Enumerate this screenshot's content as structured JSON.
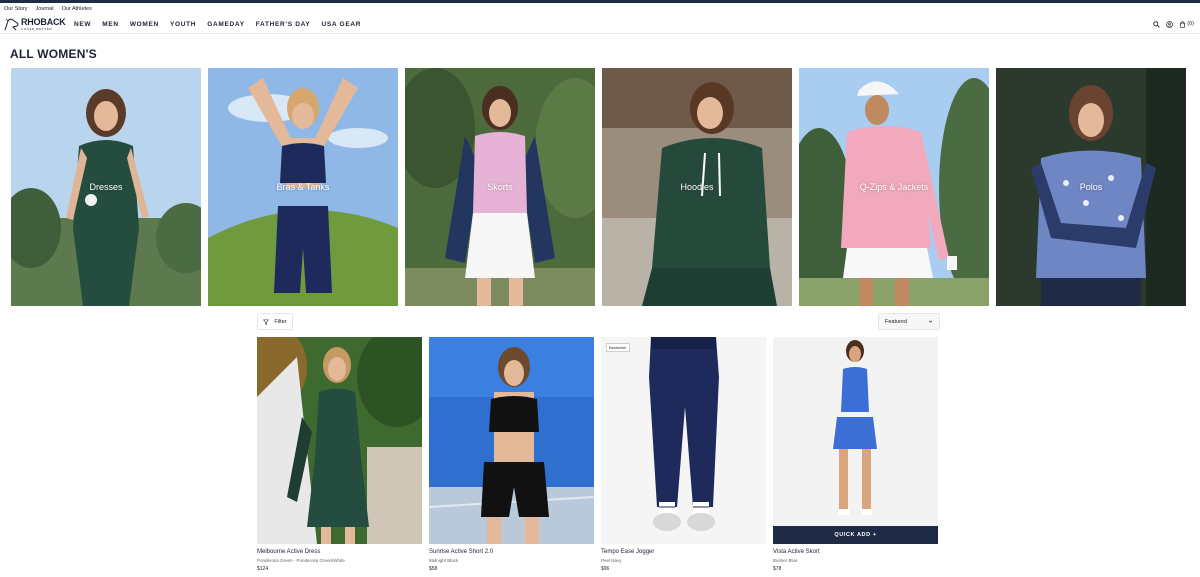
{
  "utility_links": [
    "Our Story",
    "Journal",
    "Our Athletes"
  ],
  "brand": {
    "name": "RHOBACK",
    "tagline": "CHASE BETTER"
  },
  "nav": [
    "NEW",
    "MEN",
    "WOMEN",
    "YOUTH",
    "GAMEDAY",
    "FATHER'S DAY",
    "USA GEAR"
  ],
  "header_icons": [
    "search-icon",
    "account-icon",
    "cart-icon"
  ],
  "cart_count": "(0)",
  "page_title": "ALL WOMEN'S",
  "categories": [
    {
      "label": "Dresses"
    },
    {
      "label": "Bras & Tanks"
    },
    {
      "label": "Skorts"
    },
    {
      "label": "Hoodies"
    },
    {
      "label": "Q-Zips & Jackets"
    },
    {
      "label": "Polos"
    }
  ],
  "filter_label": "Filter",
  "sort": {
    "selected": "Featured"
  },
  "products": [
    {
      "name": "Melbourne Active Dress",
      "color": "Ponderosa Green - Ponderosa Green/White",
      "price": "$124",
      "badge": "",
      "quick_add": ""
    },
    {
      "name": "Sunrise Active Short 2.0",
      "color": "Midnight Black",
      "price": "$58",
      "badge": "",
      "quick_add": ""
    },
    {
      "name": "Tempo Ease Jogger",
      "color": "Peel Navy",
      "price": "$96",
      "badge": "Bestseller",
      "quick_add": ""
    },
    {
      "name": "Vista Active Skort",
      "color": "Bunker Blue",
      "price": "$78",
      "badge": "",
      "quick_add": "QUICK ADD +"
    }
  ],
  "colors": {
    "navy": "#1f2a44",
    "dress_green": "#244d3f",
    "hoodie_green": "#254a3c",
    "pink_quarter_zip": "#f2a9bd",
    "vista_blue": "#3b6fd6",
    "sky_blue": "#a9cdf0"
  }
}
